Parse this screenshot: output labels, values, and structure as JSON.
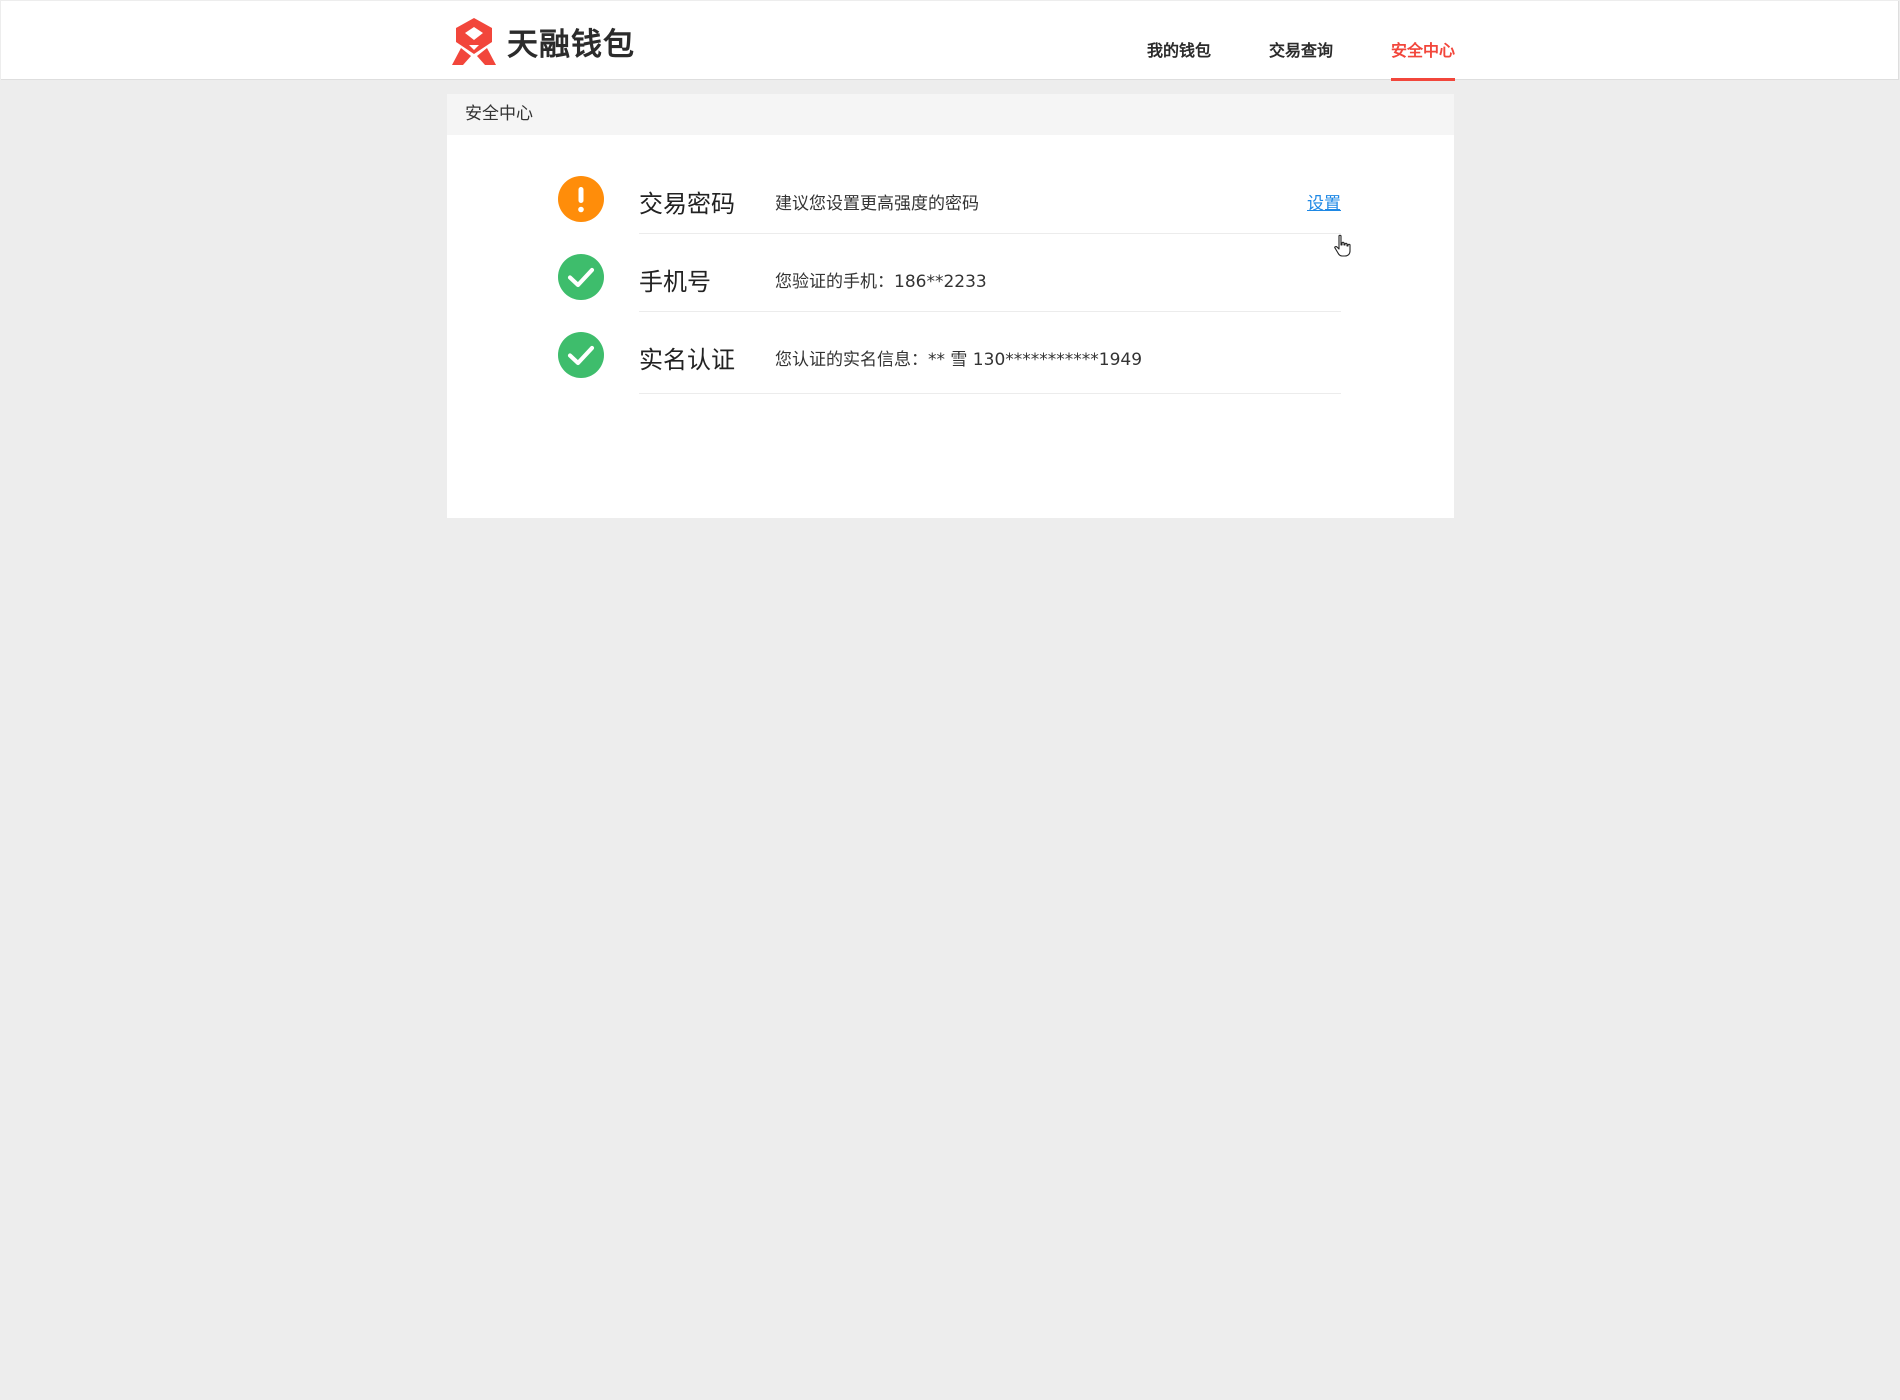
{
  "header": {
    "logo_text": "天融钱包",
    "nav": [
      {
        "label": "我的钱包",
        "active": false
      },
      {
        "label": "交易查询",
        "active": false
      },
      {
        "label": "安全中心",
        "active": true
      }
    ]
  },
  "panel": {
    "title": "安全中心",
    "items": [
      {
        "status": "warning",
        "status_icon": "exclamation-icon",
        "title": "交易密码",
        "description": "建议您设置更高强度的密码",
        "action": "设置"
      },
      {
        "status": "verified",
        "status_icon": "check-icon",
        "title": "手机号",
        "description": "您验证的手机：186**2233"
      },
      {
        "status": "verified",
        "status_icon": "check-icon",
        "title": "实名认证",
        "description": "您认证的实名信息：** 雪  130***********1949"
      }
    ]
  },
  "colors": {
    "brand_red": "#f2463b",
    "warning_orange": "#ff8d0a",
    "success_green": "#3ebd6c",
    "link_blue": "#1e88e5",
    "page_bg": "#ededed"
  }
}
